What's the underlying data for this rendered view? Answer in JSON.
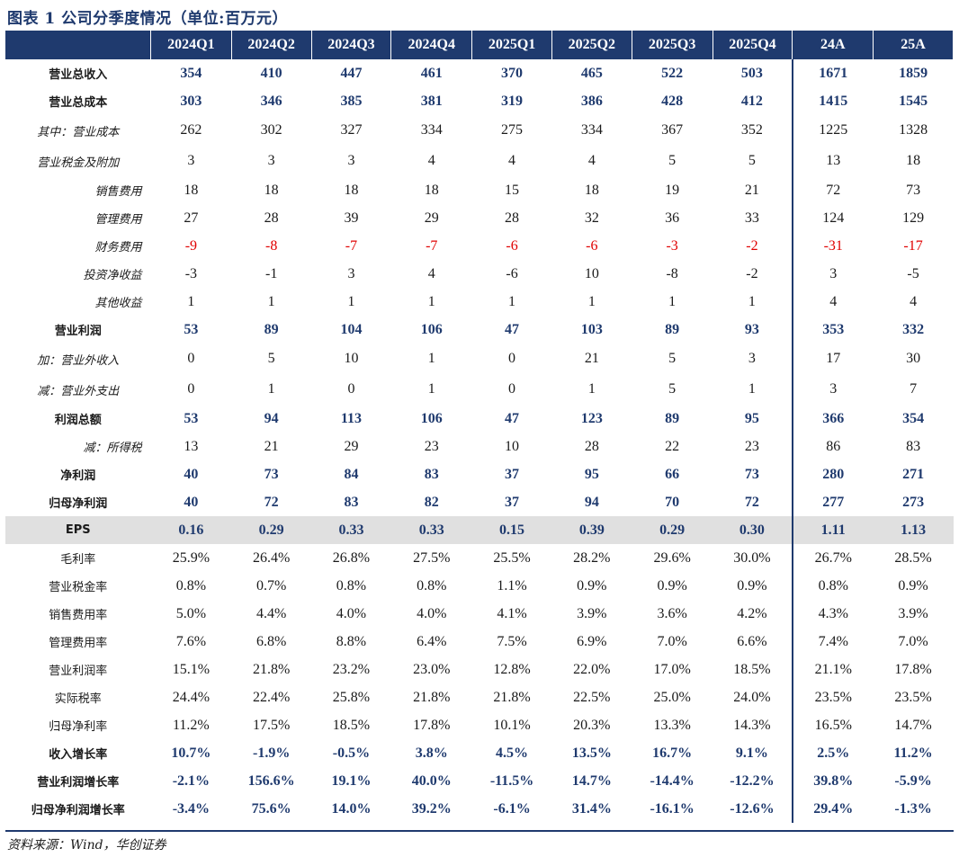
{
  "title": "图表 1    公司分季度情况（单位:百万元）",
  "columns": [
    "2024Q1",
    "2024Q2",
    "2024Q3",
    "2024Q4",
    "2025Q1",
    "2025Q2",
    "2025Q3",
    "2025Q4",
    "24A",
    "25A"
  ],
  "rows": [
    {
      "label": "营业总收入",
      "style": "bold",
      "h": 31,
      "align": "center",
      "values": [
        "354",
        "410",
        "447",
        "461",
        "370",
        "465",
        "522",
        "503",
        "1671",
        "1859"
      ]
    },
    {
      "label": "营业总成本",
      "style": "bold",
      "h": 31,
      "align": "center",
      "values": [
        "303",
        "346",
        "385",
        "381",
        "319",
        "386",
        "428",
        "412",
        "1415",
        "1545"
      ]
    },
    {
      "label": "其中：营业成本",
      "style": "ital",
      "h": 34,
      "align": "center",
      "values": [
        "262",
        "302",
        "327",
        "334",
        "275",
        "334",
        "367",
        "352",
        "1225",
        "1328"
      ]
    },
    {
      "label": "营业税金及附加",
      "style": "ital",
      "h": 34,
      "align": "center",
      "values": [
        "3",
        "3",
        "3",
        "4",
        "4",
        "4",
        "5",
        "5",
        "13",
        "18"
      ]
    },
    {
      "label": "销售费用",
      "style": "ital",
      "h": 31,
      "align": "right",
      "values": [
        "18",
        "18",
        "18",
        "18",
        "15",
        "18",
        "19",
        "21",
        "72",
        "73"
      ]
    },
    {
      "label": "管理费用",
      "style": "ital",
      "h": 31,
      "align": "right",
      "values": [
        "27",
        "28",
        "39",
        "29",
        "28",
        "32",
        "36",
        "33",
        "124",
        "129"
      ]
    },
    {
      "label": "财务费用",
      "style": "ital",
      "h": 31,
      "align": "right",
      "neg": true,
      "values": [
        "-9",
        "-8",
        "-7",
        "-7",
        "-6",
        "-6",
        "-3",
        "-2",
        "-31",
        "-17"
      ]
    },
    {
      "label": "投资净收益",
      "style": "ital",
      "h": 31,
      "align": "right",
      "values": [
        "-3",
        "-1",
        "3",
        "4",
        "-6",
        "10",
        "-8",
        "-2",
        "3",
        "-5"
      ]
    },
    {
      "label": "其他收益",
      "style": "ital",
      "h": 31,
      "align": "right",
      "values": [
        "1",
        "1",
        "1",
        "1",
        "1",
        "1",
        "1",
        "1",
        "4",
        "4"
      ]
    },
    {
      "label": "营业利润",
      "style": "bold",
      "h": 31,
      "align": "center",
      "values": [
        "53",
        "89",
        "104",
        "106",
        "47",
        "103",
        "89",
        "93",
        "353",
        "332"
      ]
    },
    {
      "label": "加：营业外收入",
      "style": "ital",
      "h": 34,
      "align": "center",
      "values": [
        "0",
        "5",
        "10",
        "1",
        "0",
        "21",
        "5",
        "3",
        "17",
        "30"
      ]
    },
    {
      "label": "减：营业外支出",
      "style": "ital",
      "h": 34,
      "align": "center",
      "values": [
        "0",
        "1",
        "0",
        "1",
        "0",
        "1",
        "5",
        "1",
        "3",
        "7"
      ]
    },
    {
      "label": "利润总额",
      "style": "bold",
      "h": 31,
      "align": "center",
      "values": [
        "53",
        "94",
        "113",
        "106",
        "47",
        "123",
        "89",
        "95",
        "366",
        "354"
      ]
    },
    {
      "label": "减：所得税",
      "style": "ital",
      "h": 31,
      "align": "right",
      "values": [
        "13",
        "21",
        "29",
        "23",
        "10",
        "28",
        "22",
        "23",
        "86",
        "83"
      ]
    },
    {
      "label": "净利润",
      "style": "bold",
      "h": 31,
      "align": "center",
      "values": [
        "40",
        "73",
        "84",
        "83",
        "37",
        "95",
        "66",
        "73",
        "280",
        "271"
      ]
    },
    {
      "label": "归母净利润",
      "style": "bold",
      "h": 31,
      "align": "center",
      "values": [
        "40",
        "72",
        "83",
        "82",
        "37",
        "94",
        "70",
        "72",
        "277",
        "273"
      ]
    },
    {
      "label": "EPS",
      "style": "bold eps",
      "h": 31,
      "align": "center",
      "values": [
        "0.16",
        "0.29",
        "0.33",
        "0.33",
        "0.15",
        "0.39",
        "0.29",
        "0.30",
        "1.11",
        "1.13"
      ]
    },
    {
      "label": "毛利率",
      "style": "plain",
      "h": 31,
      "align": "center",
      "values": [
        "25.9%",
        "26.4%",
        "26.8%",
        "27.5%",
        "25.5%",
        "28.2%",
        "29.6%",
        "30.0%",
        "26.7%",
        "28.5%"
      ]
    },
    {
      "label": "营业税金率",
      "style": "plain",
      "h": 31,
      "align": "center",
      "values": [
        "0.8%",
        "0.7%",
        "0.8%",
        "0.8%",
        "1.1%",
        "0.9%",
        "0.9%",
        "0.9%",
        "0.8%",
        "0.9%"
      ]
    },
    {
      "label": "销售费用率",
      "style": "plain",
      "h": 31,
      "align": "center",
      "values": [
        "5.0%",
        "4.4%",
        "4.0%",
        "4.0%",
        "4.1%",
        "3.9%",
        "3.6%",
        "4.2%",
        "4.3%",
        "3.9%"
      ]
    },
    {
      "label": "管理费用率",
      "style": "plain",
      "h": 31,
      "align": "center",
      "values": [
        "7.6%",
        "6.8%",
        "8.8%",
        "6.4%",
        "7.5%",
        "6.9%",
        "7.0%",
        "6.6%",
        "7.4%",
        "7.0%"
      ]
    },
    {
      "label": "营业利润率",
      "style": "plain",
      "h": 31,
      "align": "center",
      "values": [
        "15.1%",
        "21.8%",
        "23.2%",
        "23.0%",
        "12.8%",
        "22.0%",
        "17.0%",
        "18.5%",
        "21.1%",
        "17.8%"
      ]
    },
    {
      "label": "实际税率",
      "style": "plain",
      "h": 31,
      "align": "center",
      "values": [
        "24.4%",
        "22.4%",
        "25.8%",
        "21.8%",
        "21.8%",
        "22.5%",
        "25.0%",
        "24.0%",
        "23.5%",
        "23.5%"
      ]
    },
    {
      "label": "归母净利率",
      "style": "plain",
      "h": 31,
      "align": "center",
      "values": [
        "11.2%",
        "17.5%",
        "18.5%",
        "17.8%",
        "10.1%",
        "20.3%",
        "13.3%",
        "14.3%",
        "16.5%",
        "14.7%"
      ]
    },
    {
      "label": "收入增长率",
      "style": "bold",
      "h": 31,
      "align": "center",
      "values": [
        "10.7%",
        "-1.9%",
        "-0.5%",
        "3.8%",
        "4.5%",
        "13.5%",
        "16.7%",
        "9.1%",
        "2.5%",
        "11.2%"
      ]
    },
    {
      "label": "营业利润增长率",
      "style": "bold",
      "h": 31,
      "align": "center",
      "values": [
        "-2.1%",
        "156.6%",
        "19.1%",
        "40.0%",
        "-11.5%",
        "14.7%",
        "-14.4%",
        "-12.2%",
        "39.8%",
        "-5.9%"
      ]
    },
    {
      "label": "归母净利润增长率",
      "style": "bold",
      "h": 31,
      "align": "center",
      "values": [
        "-3.4%",
        "75.6%",
        "14.0%",
        "39.2%",
        "-6.1%",
        "31.4%",
        "-16.1%",
        "-12.6%",
        "29.4%",
        "-1.3%"
      ]
    }
  ],
  "source": "资料来源：Wind，华创证券",
  "colors": {
    "header_bg": "#1f3a6e",
    "negative": "#e00000",
    "eps_bg": "#e0e0e0"
  }
}
